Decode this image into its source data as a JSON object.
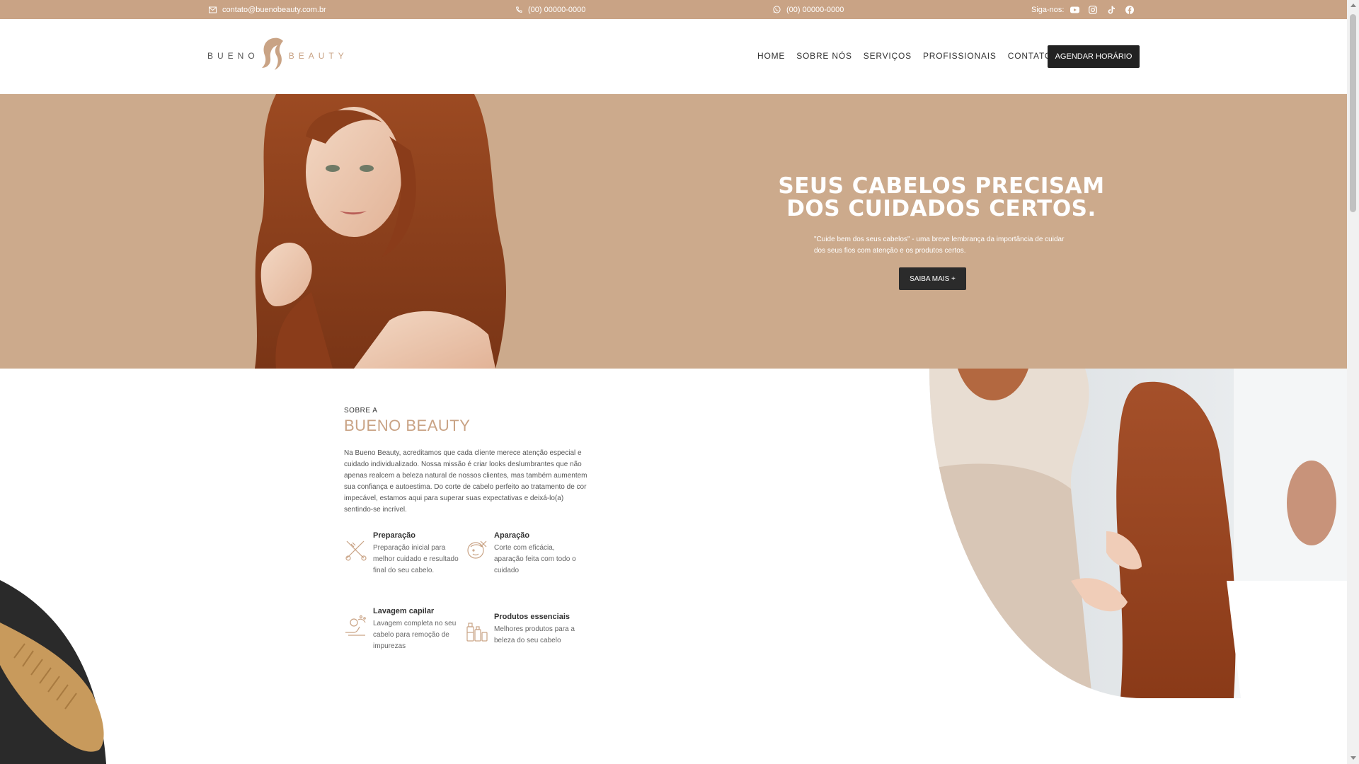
{
  "topbar": {
    "email": "contato@buenobeauty.com.br",
    "phone": "(00) 00000-0000",
    "whatsapp": "(00) 00000-0000",
    "follow_label": "Siga-nos:",
    "social_icons": [
      "youtube-icon",
      "instagram-icon",
      "tiktok-icon",
      "facebook-icon"
    ]
  },
  "header": {
    "logo_word1": "BUENO",
    "logo_word2": "BEAUTY",
    "nav": [
      "HOME",
      "SOBRE NÓS",
      "SERVIÇOS",
      "PROFISSIONAIS",
      "CONTATO"
    ],
    "cta": "AGENDAR HORÁRIO"
  },
  "hero": {
    "title_line1": "SEUS CABELOS PRECISAM",
    "title_line2": "DOS CUIDADOS CERTOS.",
    "subtitle": "\"Cuide bem dos seus cabelos\" - uma breve lembrança da importância de cuidar dos seus fios com atenção e os produtos certos.",
    "button": "SAIBA MAIS +"
  },
  "about": {
    "eyebrow": "SOBRE A",
    "title": "BUENO BEAUTY",
    "body": "Na Bueno Beauty, acreditamos que cada cliente merece atenção especial e cuidado individualizado. Nossa missão é criar looks deslumbrantes que não apenas realcem a beleza natural de nossos clientes, mas também aumentem sua confiança e autoestima. Do corte de cabelo perfeito ao tratamento de cor impecável, estamos aqui para superar suas expectativas e deixá-lo(a) sentindo-se incrível.",
    "features": [
      {
        "title": "Preparação",
        "desc": "Preparação inicial para melhor cuidado e resultado final do seu cabelo."
      },
      {
        "title": "Aparação",
        "desc": "Corte com eficácia, aparação feita com todo o cuidado"
      },
      {
        "title": "Lavagem capilar",
        "desc": "Lavagem completa no seu cabelo para remoção de impurezas"
      },
      {
        "title": "Produtos essenciais",
        "desc": "Melhores produtos para a beleza do seu cabelo"
      }
    ]
  },
  "colors": {
    "accent": "#c9a385",
    "hero_bg": "#ccaa8c",
    "dark_button": "#222222"
  }
}
